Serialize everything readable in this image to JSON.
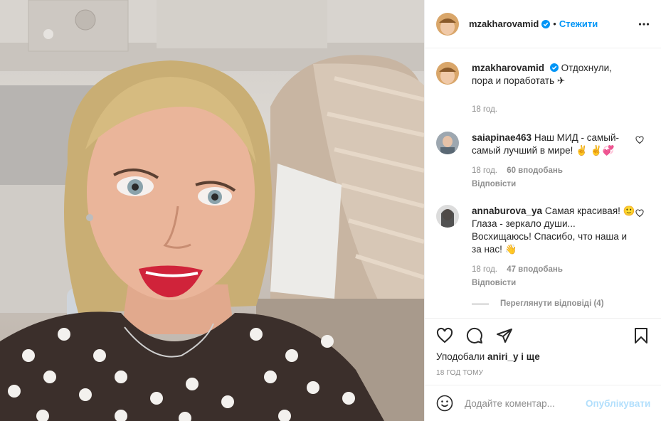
{
  "post": {
    "username": "mzakharovamid",
    "follow_label": "Стежити",
    "caption": "Отдохнули, пора и поработать ✈",
    "caption_time": "18 год."
  },
  "comments": [
    {
      "username": "saiapinae463",
      "text": "Наш МИД - самый-самый лучший в мире! ✌ ✌💞",
      "time": "18 год.",
      "likes": "60 вподобань",
      "reply_label": "Відповісти"
    },
    {
      "username": "annaburova_ya",
      "text": "Самая красивая! 🙂 Глаза - зеркало души... Восхищаюсь! Спасибо, что наша и за нас! 👋",
      "time": "18 год.",
      "likes": "47 вподобань",
      "reply_label": "Відповісти",
      "view_replies": "Переглянути відповіді (4)"
    }
  ],
  "likes_line": {
    "prefix": "Уподобали",
    "user": "aniri_y",
    "suffix": "і ще"
  },
  "timestamp": "18 год тому",
  "add_comment": {
    "placeholder": "Додайте коментар...",
    "post_label": "Опублікувати"
  },
  "icons": [
    "heart-icon",
    "comment-icon",
    "share-icon",
    "save-icon",
    "more-icon",
    "verified-icon",
    "emoji-icon"
  ],
  "colors": {
    "accent": "#0095f6",
    "post_disabled": "#b2dffc",
    "muted": "#8e8e8e",
    "lipstick": "#d0233a"
  }
}
